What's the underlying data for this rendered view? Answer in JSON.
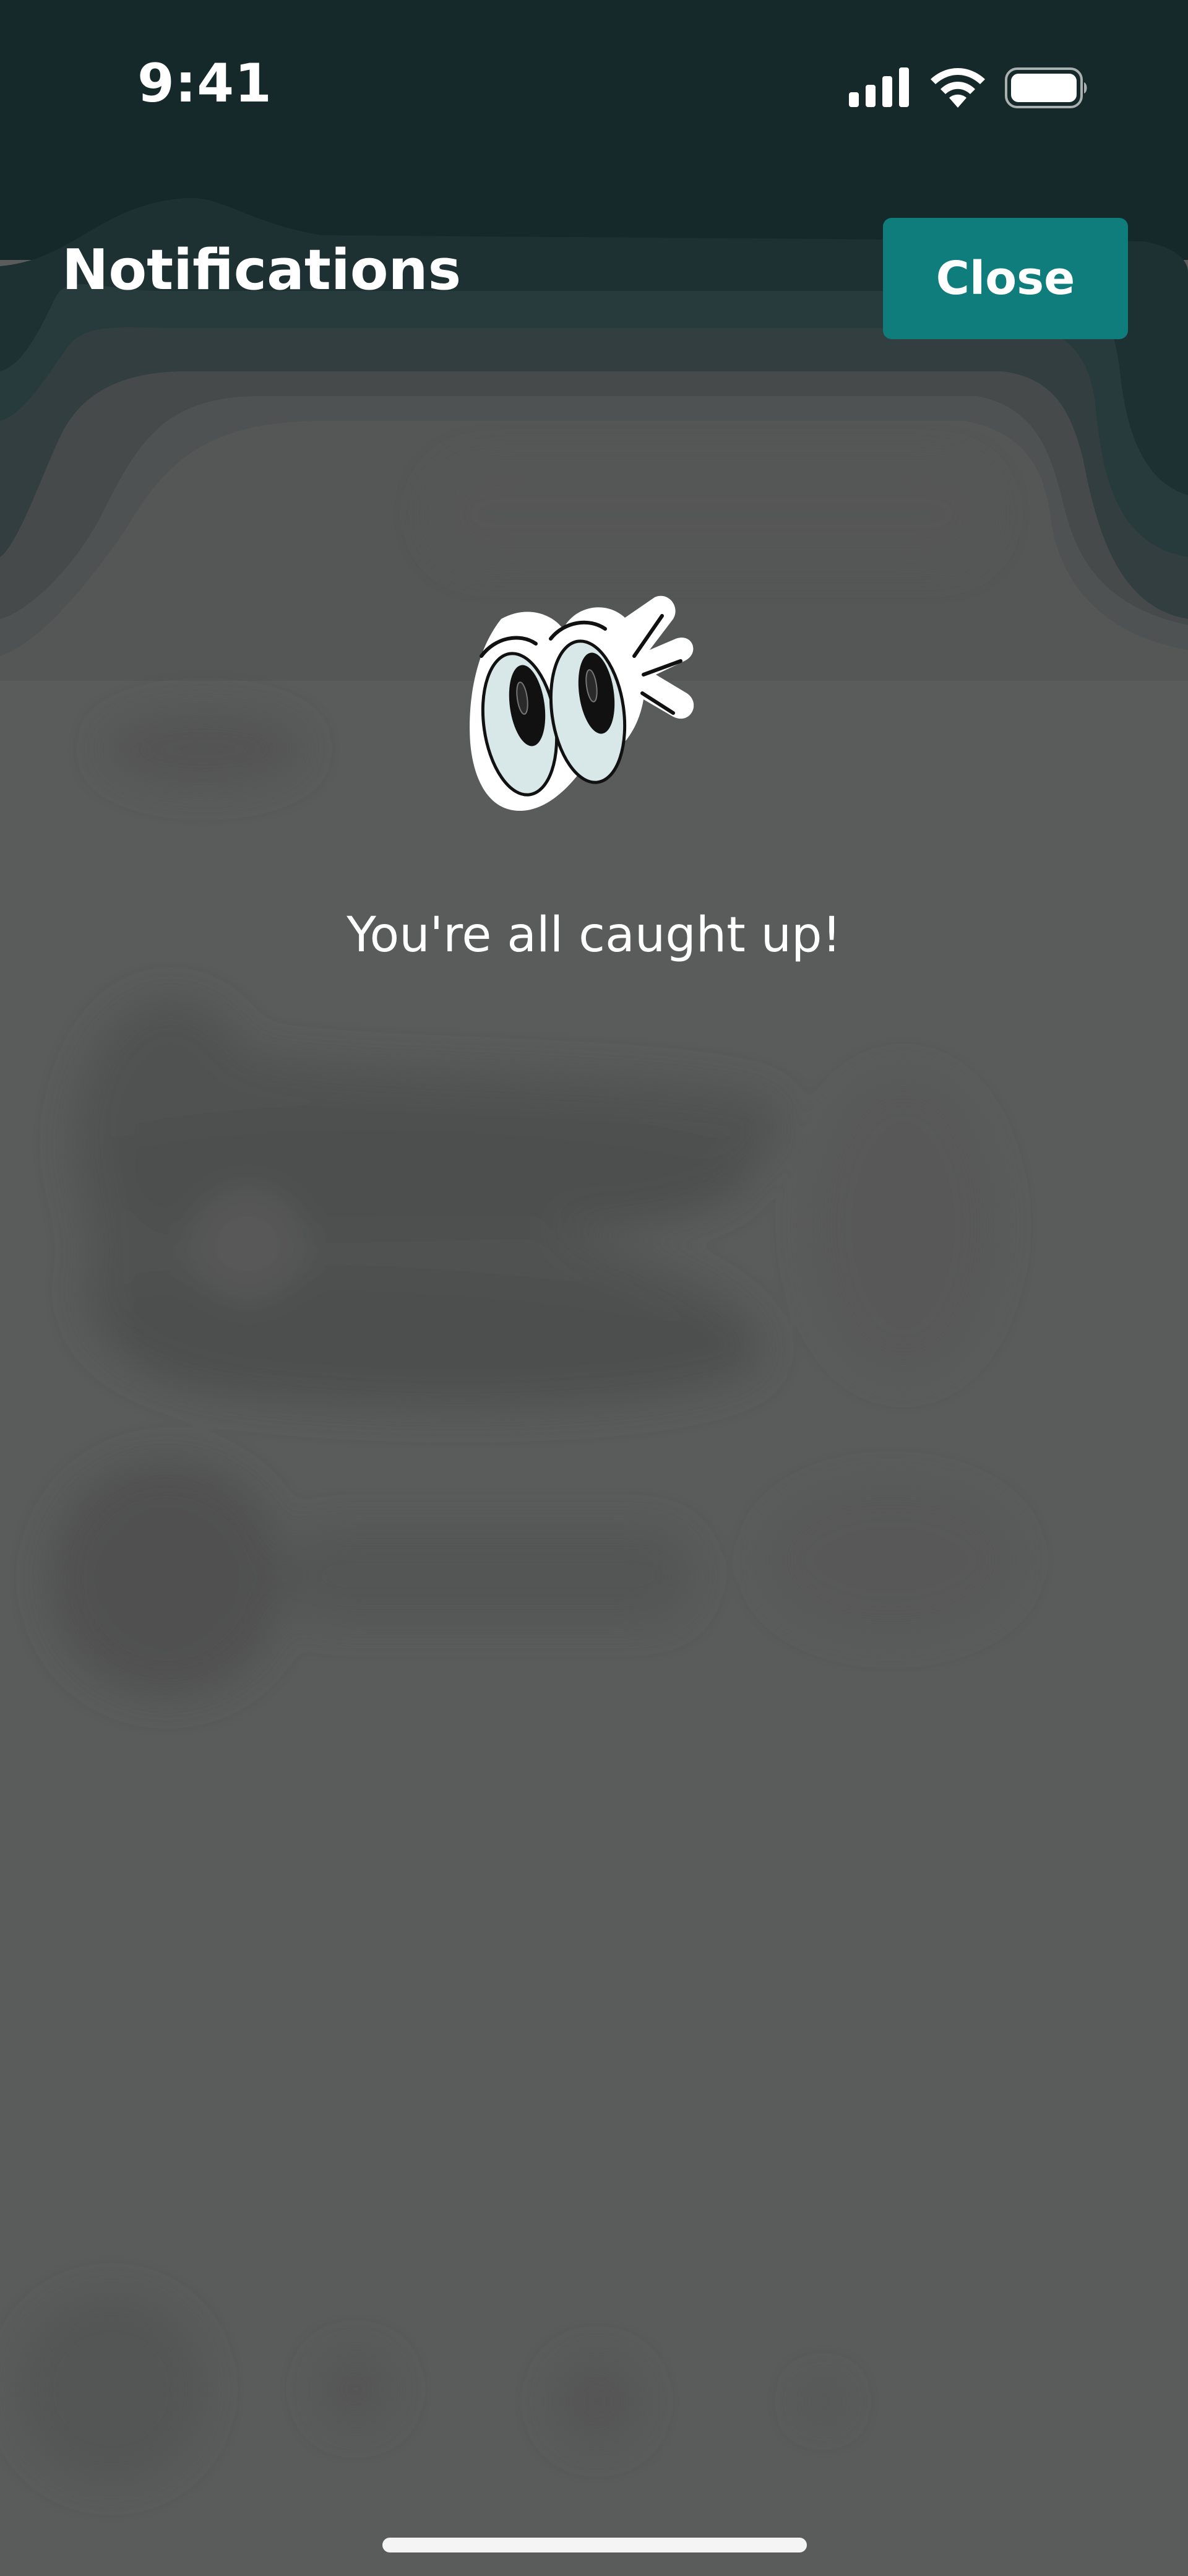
{
  "status_bar": {
    "time": "9:41",
    "icons": [
      "cellular-signal-icon",
      "wifi-icon",
      "battery-icon"
    ]
  },
  "header": {
    "title": "Notifications",
    "close_label": "Close"
  },
  "empty_state": {
    "illustration": "cartoon-eyes-icon",
    "message": "You're all caught up!"
  },
  "colors": {
    "overlay_background": "#5a5b5b",
    "header_background": "#15282a",
    "close_button": "#0e7d7b",
    "text": "#ffffff"
  }
}
